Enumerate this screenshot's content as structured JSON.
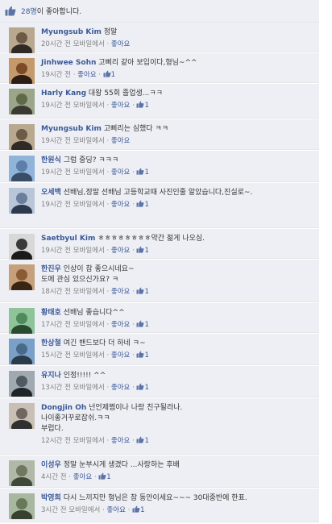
{
  "likes": {
    "count": "28명",
    "suffix": "이 좋아합니다."
  },
  "comments": [
    {
      "author": "Myungsub Kim",
      "text": "정말",
      "time": "20시간 전 모바일에서",
      "sep": "·",
      "like": "좋아요",
      "likes": ""
    },
    {
      "author": "Jinhwee Sohn",
      "text": "고삐리 같아 보입이다,형님~^^",
      "time": "19시간 전",
      "sep": "·",
      "like": "좋아요",
      "likes": "1"
    },
    {
      "author": "Harly Kang",
      "text": "대왕 55회 졸업생...ㅋㅋ",
      "time": "19시간 전 모바일에서",
      "sep": "·",
      "like": "좋아요",
      "likes": "1"
    },
    {
      "author": "Myungsub Kim",
      "text": "고삐리는 심했다 ㅋㅋ",
      "time": "19시간 전 모바일에서",
      "sep": "·",
      "like": "좋아요",
      "likes": ""
    },
    {
      "author": "한원식",
      "text": "그럼 중딩? ㅋㅋㅋ",
      "time": "19시간 전 모바일에서",
      "sep": "·",
      "like": "좋아요",
      "likes": "1"
    },
    {
      "author": "오세백",
      "text": "선배님,정말 선배님 고등학교때 사진인줄 알았습니다,진실로~.",
      "time": "19시간 전 모바일에서",
      "sep": "·",
      "like": "좋아요",
      "likes": "1"
    },
    {
      "author": "Saetbyul Kim",
      "text": "ㅎㅎㅎㅎㅎㅎㅎㅎ약간 젊게 나오심.",
      "time": "19시간 전 모바일에서",
      "sep": "·",
      "like": "좋아요",
      "likes": "1"
    },
    {
      "author": "한진우",
      "text": "인상이 참 좋으시네요~\n도에 관심 있으신가요? ㅋ",
      "time": "18시간 전 모바일에서",
      "sep": "·",
      "like": "좋아요",
      "likes": "1"
    },
    {
      "author": "황태호",
      "text": "선배님 좋습니다^^",
      "time": "17시간 전 모바일에서",
      "sep": "·",
      "like": "좋아요",
      "likes": "1"
    },
    {
      "author": "한상철",
      "text": "여긴 밴드보다 더 하네 ㅋ~",
      "time": "15시간 전 모바일에서",
      "sep": "·",
      "like": "좋아요",
      "likes": "1"
    },
    {
      "author": "유지나",
      "text": "인정!!!!! ^^",
      "time": "13시간 전 모바일에서",
      "sep": "·",
      "like": "좋아요",
      "likes": "1"
    },
    {
      "author": "Dongjin Oh",
      "text": "넌언제쩜이나 나랑 친구될라나.\n나이좋거꾸로잡쉬.ㅋㅋ\n부럽다.",
      "time": "12시간 전 모바일에서",
      "sep": "·",
      "like": "좋아요",
      "likes": "1"
    },
    {
      "author": "이성우",
      "text": "정말 눈부시게 생겼다 ...사랑하는 후배",
      "time": "4시간 전",
      "sep": "·",
      "like": "좋아요",
      "likes": "1"
    },
    {
      "author": "박영희",
      "text": "다시 느끼지만 형님은 참 동안이세요~~~ 30대중반에 한표.",
      "time": "3시간 전 모바일에서",
      "sep": "·",
      "like": "좋아요",
      "likes": "1"
    }
  ],
  "colors": {
    "link": "#3b5998",
    "background": "#edeff4",
    "meta": "#808080"
  }
}
